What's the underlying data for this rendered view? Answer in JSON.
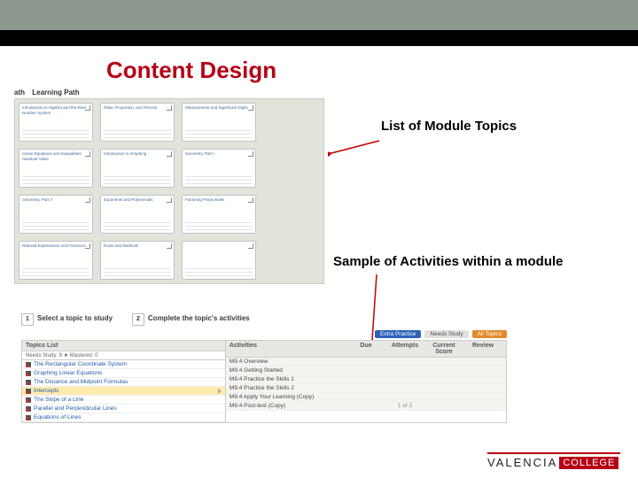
{
  "title": "Content Design",
  "annotation1": "List of Module Topics",
  "annotation2": "Sample of Activities within a module",
  "learning_path": {
    "breadcrumb1": "ath",
    "breadcrumb2": "Learning Path",
    "modules": [
      "Introduction to Algebra and the Real Number System",
      "Ratio, Proportion, and Percent",
      "Measurement and Significant Digits",
      "Linear Equations and Inequalities; Absolute Value",
      "Introduction to Graphing",
      "Geometry, Part I",
      "Geometry, Part II",
      "Exponents and Polynomials",
      "Factoring Polynomials",
      "Rational Expressions and Functions",
      "Roots and Radicals",
      ""
    ]
  },
  "activities": {
    "step1_num": "1",
    "step1": "Select a topic to study",
    "step2_num": "2",
    "step2": "Complete the topic's activities",
    "extra_btn": "Extra Practice",
    "tab1": "Needs Study",
    "tab2": "All Topics",
    "left_header": "Topics List",
    "meta": "Needs Study: 9   ★ Mastered: 0",
    "topics": [
      "The Rectangular Coordinate System",
      "Graphing Linear Equations",
      "The Distance and Midpoint Formulas",
      "Intercepts",
      "The Slope of a Line",
      "Parallel and Perpendicular Lines",
      "Equations of Lines"
    ],
    "right_headers": [
      "Activities",
      "Due",
      "Attempts",
      "Current Score",
      "Review"
    ],
    "rows": [
      {
        "name": "M9.4 Overview",
        "attempts": ""
      },
      {
        "name": "M9.4 Getting Started",
        "attempts": ""
      },
      {
        "name": "M9.4 Practice the Skills 1",
        "attempts": ""
      },
      {
        "name": "M9.4 Practice the Skills 2",
        "attempts": ""
      },
      {
        "name": "M9.4 Apply Your Learning (Copy)",
        "attempts": ""
      },
      {
        "name": "M9.4 Post-test (Copy)",
        "attempts": "1 of 2"
      }
    ]
  },
  "logo": {
    "a": "VALENCIA",
    "b": "COLLEGE"
  }
}
